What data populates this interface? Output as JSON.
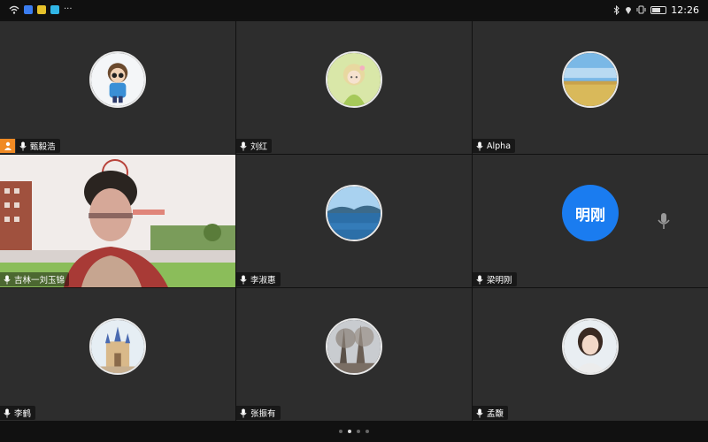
{
  "status_bar": {
    "time": "12:26",
    "left_icons": [
      "wifi-icon",
      "app-icon-blue",
      "app-icon-yellow",
      "app-icon-cyan",
      "more-dots-icon"
    ],
    "right_icons": [
      "bluetooth-icon",
      "location-icon",
      "vibrate-icon",
      "battery-icon"
    ],
    "more_label": "···",
    "battery_level": 0.6
  },
  "participants": [
    {
      "name": "甄毅浩",
      "host": true,
      "avatar": "cartoon-boy"
    },
    {
      "name": "刘红",
      "avatar": "cartoon-girl"
    },
    {
      "name": "Alpha",
      "avatar": "landscape-field"
    },
    {
      "name": "吉林一刘玉锦",
      "avatar": "video",
      "active": true
    },
    {
      "name": "李淑惠",
      "avatar": "lake"
    },
    {
      "name": "梁明刚",
      "avatar_text": "明刚",
      "avatar_color": "#1a7cf0"
    },
    {
      "name": "李鹤",
      "avatar": "castle"
    },
    {
      "name": "张振有",
      "avatar": "trees"
    },
    {
      "name": "孟馥",
      "avatar": "portrait"
    }
  ],
  "pager": {
    "pages": 4,
    "current": 2
  },
  "colors": {
    "host_badge": "#f08a24",
    "active_border": "#2fbf71",
    "tile_bg": "#2d2d2d",
    "text_avatar": "#1a7cf0"
  }
}
